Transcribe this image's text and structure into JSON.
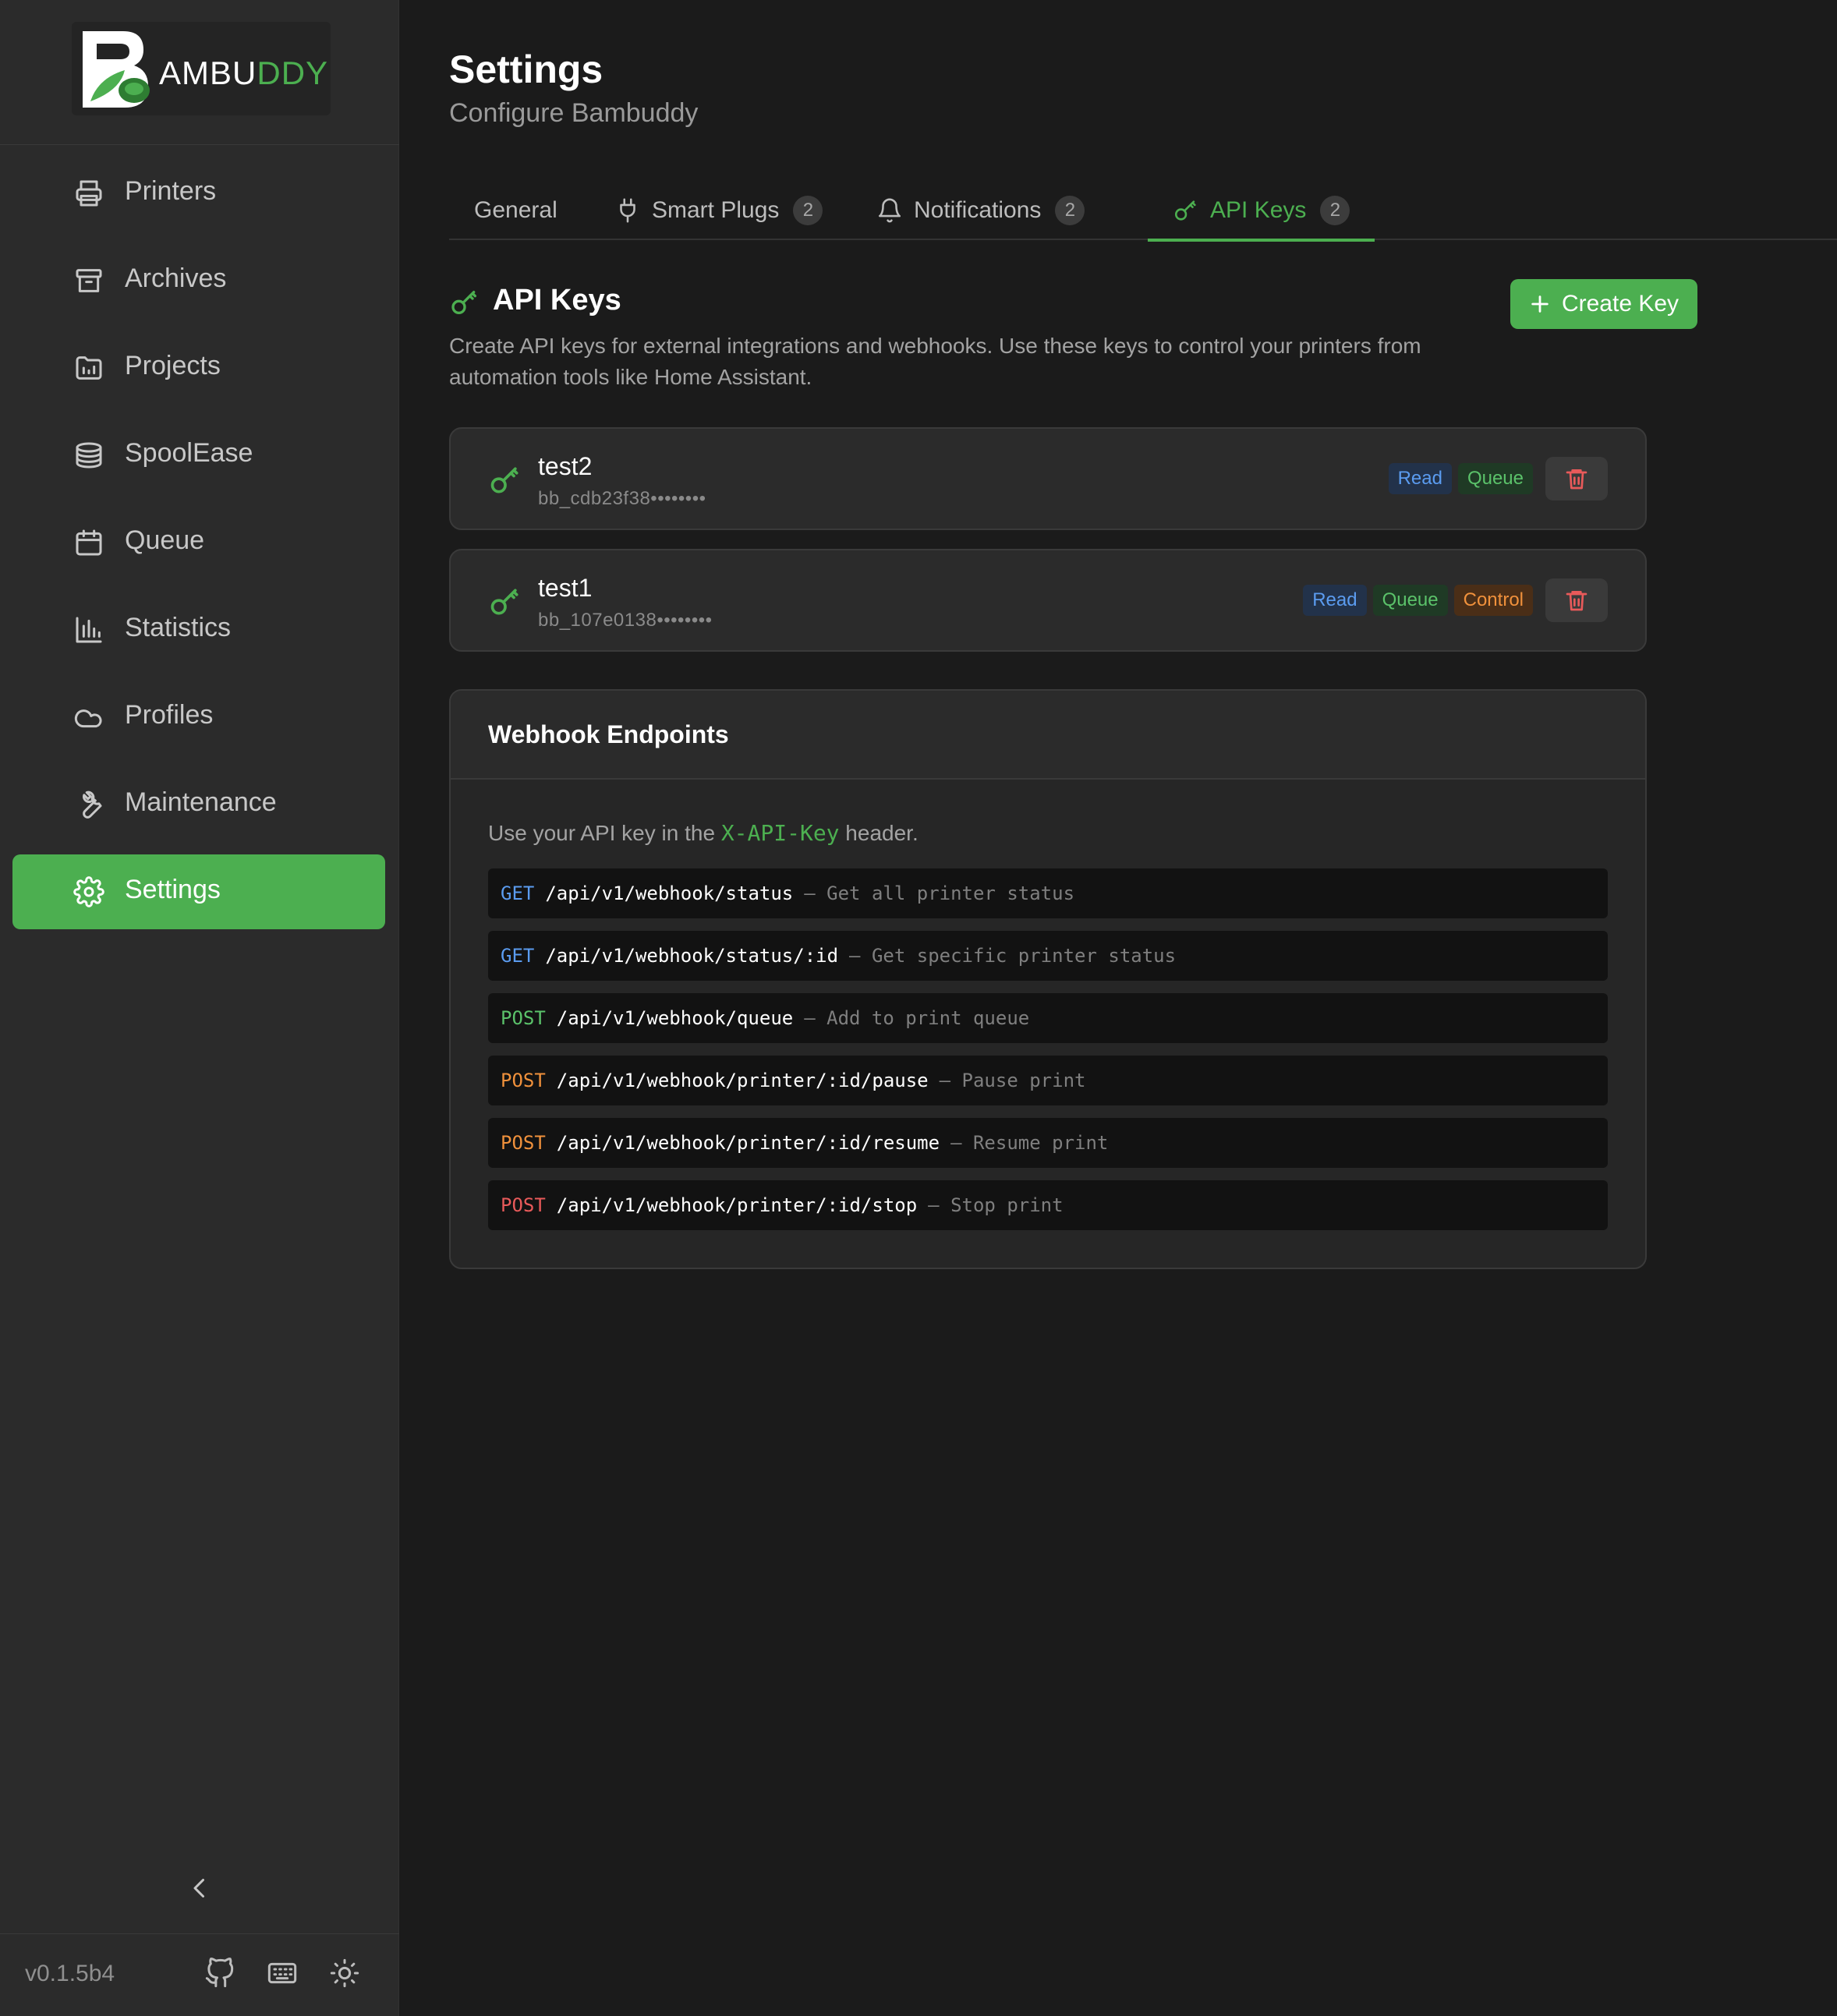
{
  "brand": {
    "logo_text_main": "AMBU",
    "logo_text_accent": "DDY",
    "green": "#4caf50"
  },
  "sidebar": {
    "items": [
      {
        "label": "Printers",
        "icon": "printer-icon"
      },
      {
        "label": "Archives",
        "icon": "archive-icon"
      },
      {
        "label": "Projects",
        "icon": "folder-icon"
      },
      {
        "label": "SpoolEase",
        "icon": "layers-icon"
      },
      {
        "label": "Queue",
        "icon": "calendar-icon"
      },
      {
        "label": "Statistics",
        "icon": "bar-chart-icon"
      },
      {
        "label": "Profiles",
        "icon": "cloud-icon"
      },
      {
        "label": "Maintenance",
        "icon": "wrench-icon"
      },
      {
        "label": "Settings",
        "icon": "gear-icon",
        "active": true
      }
    ],
    "version": "v0.1.5b4"
  },
  "header": {
    "title": "Settings",
    "subtitle": "Configure Bambuddy"
  },
  "tabs": [
    {
      "label": "General"
    },
    {
      "label": "Smart Plugs",
      "count": "2",
      "icon": "plug-icon"
    },
    {
      "label": "Notifications",
      "count": "2",
      "icon": "bell-icon"
    },
    {
      "label": "API Keys",
      "count": "2",
      "icon": "key-icon",
      "active": true
    }
  ],
  "api_keys": {
    "title": "API Keys",
    "description": "Create API keys for external integrations and webhooks. Use these keys to control your printers from automation tools like Home Assistant.",
    "create_label": "Create Key",
    "keys": [
      {
        "name": "test2",
        "prefix": "bb_cdb23f38••••••••",
        "perms": [
          "Read",
          "Queue"
        ]
      },
      {
        "name": "test1",
        "prefix": "bb_107e0138••••••••",
        "perms": [
          "Read",
          "Queue",
          "Control"
        ]
      }
    ]
  },
  "webhooks": {
    "title": "Webhook Endpoints",
    "desc_before": "Use your API key in the ",
    "desc_code": "X-API-Key",
    "desc_after": " header.",
    "endpoints": [
      {
        "method": "GET",
        "path": "/api/v1/webhook/status",
        "desc": "– Get all printer status"
      },
      {
        "method": "GET",
        "path": "/api/v1/webhook/status/:id",
        "desc": "– Get specific printer status"
      },
      {
        "method": "POST",
        "path": "/api/v1/webhook/queue",
        "desc": "– Add to print queue"
      },
      {
        "method": "POST",
        "path": "/api/v1/webhook/printer/:id/pause",
        "desc": "– Pause print"
      },
      {
        "method": "POST",
        "path": "/api/v1/webhook/printer/:id/resume",
        "desc": "– Resume print"
      },
      {
        "method": "POST",
        "path": "/api/v1/webhook/printer/:id/stop",
        "desc": "– Stop print"
      }
    ]
  }
}
